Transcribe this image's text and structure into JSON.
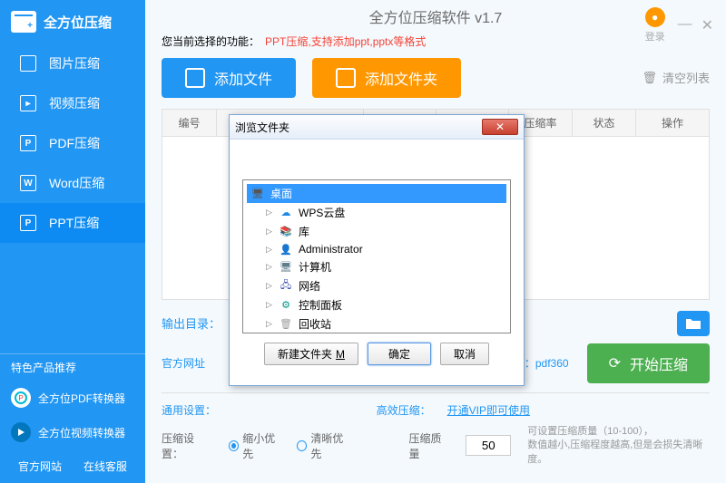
{
  "app": {
    "title": "全方位压缩软件 v1.7",
    "logo_text": "全方位压缩",
    "login_label": "登录"
  },
  "sidebar": {
    "items": [
      {
        "icon": "",
        "label": "图片压缩"
      },
      {
        "icon": "▸",
        "label": "视频压缩"
      },
      {
        "icon": "P",
        "label": "PDF压缩"
      },
      {
        "icon": "W",
        "label": "Word压缩"
      },
      {
        "icon": "P",
        "label": "PPT压缩"
      }
    ],
    "recommend_label": "特色产品推荐",
    "recommends": [
      {
        "label": "全方位PDF转换器"
      },
      {
        "label": "全方位视频转换器"
      }
    ],
    "footer": {
      "site": "官方网站",
      "support": "在线客服"
    }
  },
  "toolbar": {
    "func_prefix": "您当前选择的功能：",
    "func_hint": "PPT压缩,支持添加ppt,pptx等格式",
    "add_file": "添加文件",
    "add_folder": "添加文件夹",
    "clear_list": "清空列表"
  },
  "table": {
    "headers": [
      "编号",
      "",
      "",
      "",
      "压缩率",
      "状态",
      "操作"
    ]
  },
  "output": {
    "label": "输出目录：",
    "path": ""
  },
  "links": {
    "official_prefix": "官方网址",
    "official_suffix": "：pdf360"
  },
  "start_btn": "开始压缩",
  "settings": {
    "general_label": "通用设置：",
    "efficient_label": "高效压缩：",
    "vip_link": "开通VIP即可使用",
    "compress_label": "压缩设置：",
    "radio1": "缩小优先",
    "radio2": "清晰优先",
    "quality_label": "压缩质量",
    "quality_value": "50",
    "quality_hint1": "可设置压缩质量（10-100），",
    "quality_hint2": "数值越小,压缩程度越高,但是会损失清晰度。"
  },
  "dialog": {
    "title": "浏览文件夹",
    "tree": [
      {
        "label": "桌面",
        "root": true,
        "icon": "🖥"
      },
      {
        "label": "WPS云盘",
        "icon": "☁",
        "color": "#1e88e5"
      },
      {
        "label": "库",
        "icon": "📚",
        "color": "#4caf50"
      },
      {
        "label": "Administrator",
        "icon": "👤",
        "color": "#ff9800"
      },
      {
        "label": "计算机",
        "icon": "🖥",
        "color": "#607d8b"
      },
      {
        "label": "网络",
        "icon": "🖧",
        "color": "#3f51b5"
      },
      {
        "label": "控制面板",
        "icon": "⚙",
        "color": "#009688"
      },
      {
        "label": "回收站",
        "icon": "🗑",
        "color": "#9e9e9e"
      }
    ],
    "new_folder": "新建文件夹",
    "new_folder_suffix": "M",
    "ok": "确定",
    "cancel": "取消"
  }
}
